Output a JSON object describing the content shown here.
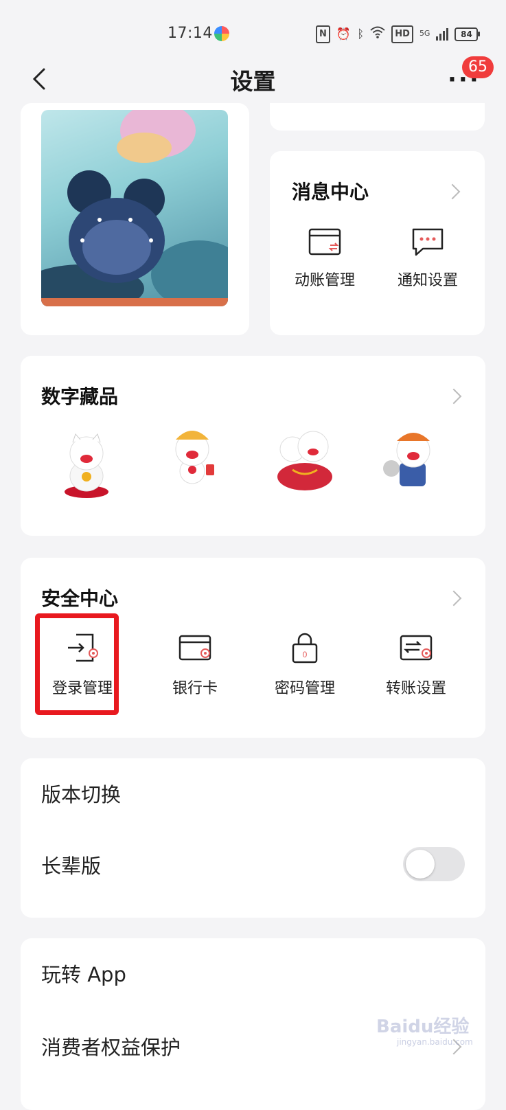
{
  "status_bar": {
    "time": "17:14",
    "hd": "HD",
    "net": "5G",
    "battery": "84"
  },
  "nav": {
    "title": "设置",
    "badge": "65"
  },
  "message_center": {
    "title": "消息中心",
    "items": [
      {
        "label": "动账管理",
        "icon": "card-transfer-icon"
      },
      {
        "label": "通知设置",
        "icon": "chat-bubble-icon"
      }
    ]
  },
  "digital_collectibles": {
    "title": "数字藏品",
    "items": [
      "lucky-cat-collectible-1",
      "lucky-cat-collectible-2",
      "lucky-cat-collectible-3",
      "lucky-cat-collectible-4"
    ]
  },
  "security_center": {
    "title": "安全中心",
    "items": [
      {
        "label": "登录管理",
        "icon": "login-icon"
      },
      {
        "label": "银行卡",
        "icon": "bank-card-icon"
      },
      {
        "label": "密码管理",
        "icon": "lock-icon",
        "glyph": "0"
      },
      {
        "label": "转账设置",
        "icon": "transfer-icon"
      }
    ]
  },
  "version_switch": {
    "title": "版本切换",
    "elder_label": "长辈版",
    "elder_on": false
  },
  "play_app": {
    "title": "玩转 App",
    "item": "消费者权益保护"
  },
  "watermark": {
    "text": "Baidu经验",
    "sub": "jingyan.baidu.com"
  },
  "colors": {
    "accent_red": "#e8191f",
    "badge_red": "#f03c3c",
    "icon_red": "#e55a5a"
  }
}
